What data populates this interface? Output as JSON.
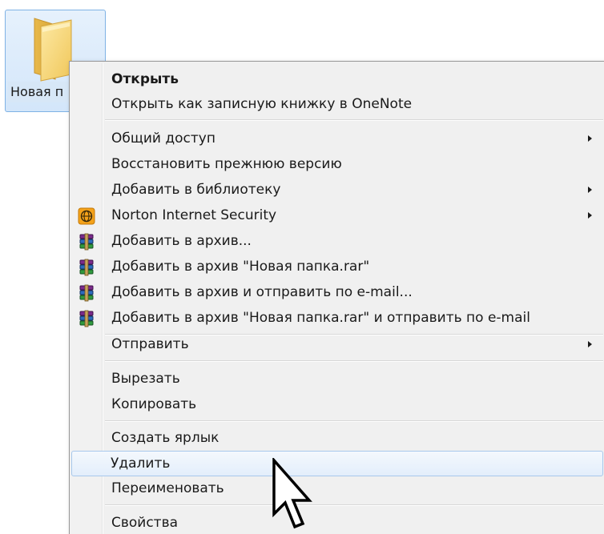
{
  "folder": {
    "label": "Новая п",
    "icon": "folder-icon"
  },
  "context_menu": {
    "items": [
      {
        "label": "Открыть",
        "bold": true
      },
      {
        "label": "Открыть как записную книжку в OneNote"
      },
      {
        "label": "Общий доступ",
        "submenu": true
      },
      {
        "label": "Восстановить прежнюю версию"
      },
      {
        "label": "Добавить в библиотеку",
        "submenu": true
      },
      {
        "label": "Norton Internet Security",
        "submenu": true,
        "icon": "norton-globe-icon"
      },
      {
        "label": "Добавить в архив...",
        "icon": "winrar-archive-icon"
      },
      {
        "label": "Добавить в архив \"Новая папка.rar\"",
        "icon": "winrar-archive-icon"
      },
      {
        "label": "Добавить в архив и отправить по e-mail...",
        "icon": "winrar-archive-icon"
      },
      {
        "label": "Добавить в архив \"Новая папка.rar\" и отправить по e-mail",
        "icon": "winrar-archive-icon"
      },
      {
        "label": "Отправить",
        "submenu": true
      },
      {
        "label": "Вырезать"
      },
      {
        "label": "Копировать"
      },
      {
        "label": "Создать ярлык"
      },
      {
        "label": "Удалить",
        "highlighted": true
      },
      {
        "label": "Переименовать"
      },
      {
        "label": "Свойства"
      }
    ]
  },
  "colors": {
    "menu_background": "#f0f0f0",
    "highlight_border": "#a8c8ec",
    "folder_selection": "#d3e6fa",
    "folder_yellow": "#f2d06b",
    "norton_orange": "#f4a21a"
  }
}
